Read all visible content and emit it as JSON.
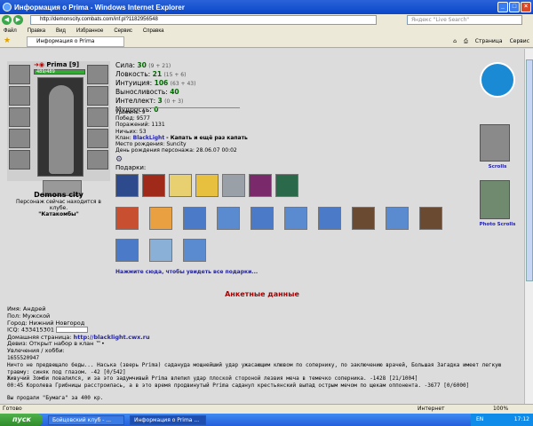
{
  "window": {
    "title": "Информация о Prima - Windows Internet Explorer"
  },
  "address": {
    "url": "http://demonscity.combats.com/inf.pl?1182956548",
    "search_placeholder": "Яндекс \"Live Search\""
  },
  "menu": [
    "Файл",
    "Правка",
    "Вид",
    "Избранное",
    "Сервис",
    "Справка"
  ],
  "tab": {
    "label": "Информация о Prima"
  },
  "tools": [
    "Страница",
    "Сервис"
  ],
  "character": {
    "name": "Prima",
    "level": "[9]",
    "hp": "489/489",
    "city": "Demons city",
    "online_text": "Персонаж сейчас находится в клубе.",
    "location": "\"Катакомбы\""
  },
  "stats": [
    {
      "label": "Сила:",
      "value": "30",
      "extra": "(9 + 21)"
    },
    {
      "label": "Ловкость:",
      "value": "21",
      "extra": "(15 + 6)"
    },
    {
      "label": "Интуиция:",
      "value": "106",
      "extra": "(63 + 43)"
    },
    {
      "label": "Выносливость:",
      "value": "40",
      "extra": ""
    },
    {
      "label": "Интеллект:",
      "value": "3",
      "extra": "(0 + 3)"
    },
    {
      "label": "Мудрость:",
      "value": "0",
      "extra": ""
    }
  ],
  "info": {
    "level_line": "Уровень: 9",
    "wins": "Побед: 9577",
    "losses": "Поражений: 1131",
    "draws": "Ничьих: 53",
    "clan_label": "Клан:",
    "clan_name": "BlackLight",
    "clan_motto": "- Капать и ещё раз капать",
    "birthplace": "Место рождения: Suncity",
    "birthdate": "День рождения персонажа: 28.06.07 00:02"
  },
  "gifts": {
    "title": "Подарки:",
    "more": "Нажмите сюда, чтобы увидеть все подарки..."
  },
  "right": {
    "scrolls": "Scrolls",
    "photo": "Photo Scrolls"
  },
  "anketa": {
    "title": "Анкетные данные",
    "name": "Имя: Андрей",
    "sex": "Пол: Мужской",
    "city": "Город: Нижний Новгород",
    "icq": "ICQ: 433415301",
    "home_label": "Домашняя страница:",
    "home_link": "http://blacklight.cwx.ru",
    "motto": "Девиз: Открыт набор в клан ™•",
    "hobby": "Увлечения / хобби:",
    "hobby_value": "1655520947",
    "log1": "Ничто не предвещало беды... Наська (зверь Prima) садануда мощнейший удар ужасающим клювом по сопернику, по заключению врачей, Большая Загадка имеет легкую травму: синяк под глазом. -42 [0/542]",
    "log2": "Живучий Зомби повалился, и за это задумчивый Prima влепил удар плоской стороной лезвия меча в темечко соперника. -1428 [21/1004]",
    "log3": "00:45 Королева Грибницы расстроилась, а в это время продвинутый Prima саданул крестьянский выпад острым мечом по щекам оппонента. -3677 [0/6000]",
    "log4": "Вы продали \"Бумага\" за 400 кр."
  },
  "status": {
    "left": "Готово",
    "zone": "Интернет",
    "zoom": "100%"
  },
  "taskbar": {
    "start": "пуск",
    "btn1": "Бойцовский клуб - ...",
    "btn2": "Информация о Prima ...",
    "lang": "EN",
    "time": "17:12"
  }
}
